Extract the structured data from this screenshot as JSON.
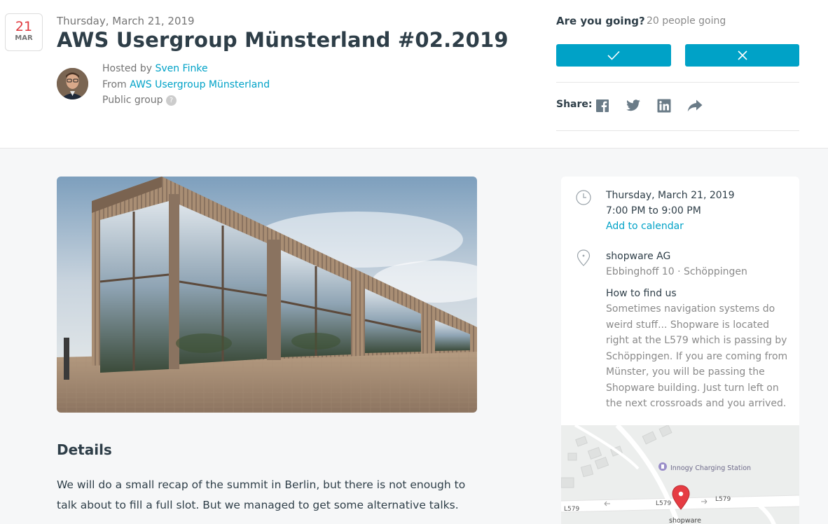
{
  "header": {
    "date_badge": {
      "day": "21",
      "month": "MAR"
    },
    "event_date": "Thursday, March 21, 2019",
    "title": "AWS Usergroup Münsterland #02.2019",
    "hosted_prefix": "Hosted by",
    "host_name": "Sven Finke",
    "from_prefix": "From",
    "group_name": "AWS Usergroup Münsterland",
    "group_type": "Public group",
    "help_glyph": "?"
  },
  "rsvp": {
    "question": "Are you going?",
    "going_count": "20 people going",
    "yes_icon": "check-icon",
    "no_icon": "close-icon",
    "accent": "#00a2c7"
  },
  "share": {
    "label": "Share:",
    "icons": [
      "facebook-icon",
      "twitter-icon",
      "linkedin-icon",
      "share-arrow-icon"
    ]
  },
  "details": {
    "heading": "Details",
    "body": "We will do a small recap of the summit in Berlin, but there is not enough to talk about to fill a full slot. But we managed to get some alternative talks."
  },
  "info_card": {
    "date": "Thursday, March 21, 2019",
    "time": "7:00 PM to 9:00 PM",
    "add_calendar": "Add to calendar",
    "venue": "shopware AG",
    "address": "Ebbinghoff 10 · Schöppingen",
    "find_us_heading": "How to find us",
    "find_us_text": "Sometimes navigation systems do weird stuff... Shopware is located right at the L579 which is passing by Schöppingen. If you are coming from Münster, you will be passing the Shopware building. Just turn left on the next crossroads and you arrived."
  },
  "map": {
    "poi": "Innogy Charging Station",
    "road_label": "L579",
    "marker_label": "shopware"
  }
}
